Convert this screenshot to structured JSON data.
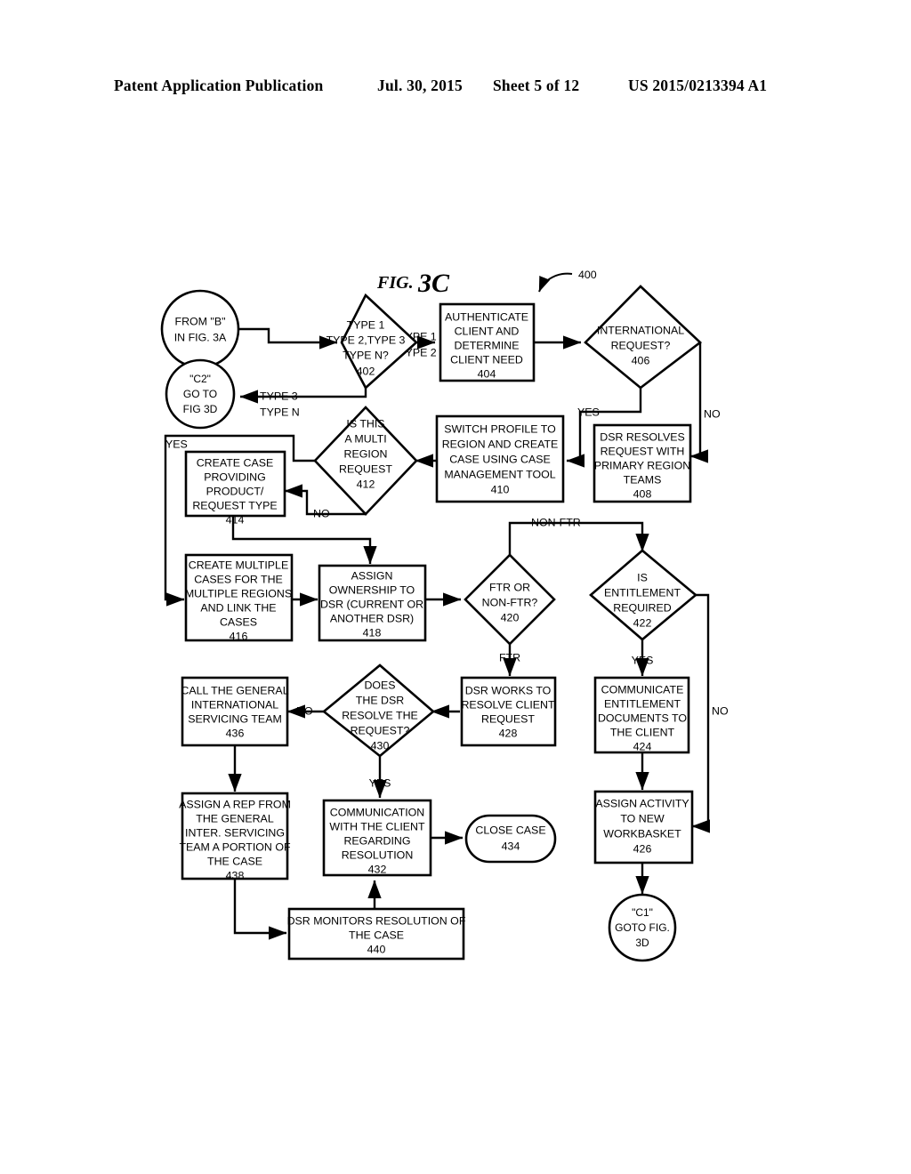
{
  "header": {
    "publication": "Patent Application Publication",
    "date": "Jul. 30, 2015",
    "sheet": "Sheet 5 of 12",
    "patent_number": "US 2015/0213394 A1"
  },
  "figure": {
    "title_prefix": "FIG.",
    "title_number": "3C",
    "diagram_ref": "400"
  },
  "nodes": {
    "from_b": {
      "id": "from_b",
      "shape": "circle",
      "lines": [
        "FROM \"B\"",
        "IN FIG. 3A"
      ],
      "ref": ""
    },
    "c2": {
      "id": "c2",
      "shape": "circle",
      "lines": [
        "\"C2\"",
        "GO TO",
        "FIG 3D"
      ],
      "ref": ""
    },
    "n402": {
      "id": "n402",
      "shape": "diamond",
      "lines": [
        "TYPE 1",
        "TYPE 2,TYPE 3",
        "TYPE N?"
      ],
      "ref": "402"
    },
    "n404": {
      "id": "n404",
      "shape": "process",
      "lines": [
        "AUTHENTICATE",
        "CLIENT AND",
        "DETERMINE",
        "CLIENT NEED"
      ],
      "ref": "404"
    },
    "n406": {
      "id": "n406",
      "shape": "diamond",
      "lines": [
        "INTERNATIONAL",
        "REQUEST?"
      ],
      "ref": "406"
    },
    "n408": {
      "id": "n408",
      "shape": "process",
      "lines": [
        "DSR RESOLVES",
        "REQUEST WITH",
        "PRIMARY REGION",
        "TEAMS"
      ],
      "ref": "408"
    },
    "n410": {
      "id": "n410",
      "shape": "process",
      "lines": [
        "SWITCH PROFILE TO",
        "REGION AND CREATE",
        "CASE USING CASE",
        "MANAGEMENT TOOL"
      ],
      "ref": "410"
    },
    "n412": {
      "id": "n412",
      "shape": "diamond",
      "lines": [
        "IS THIS",
        "A MULTI",
        "REGION",
        "REQUEST"
      ],
      "ref": "412"
    },
    "n414": {
      "id": "n414",
      "shape": "process",
      "lines": [
        "CREATE CASE",
        "PROVIDING",
        "PRODUCT/",
        "REQUEST TYPE"
      ],
      "ref": "414"
    },
    "n416": {
      "id": "n416",
      "shape": "process",
      "lines": [
        "CREATE MULTIPLE",
        "CASES FOR THE",
        "MULTIPLE REGIONS",
        "AND LINK THE",
        "CASES"
      ],
      "ref": "416"
    },
    "n418": {
      "id": "n418",
      "shape": "process",
      "lines": [
        "ASSIGN",
        "OWNERSHIP TO",
        "DSR (CURRENT OR",
        "ANOTHER DSR)"
      ],
      "ref": "418"
    },
    "n420": {
      "id": "n420",
      "shape": "diamond",
      "lines": [
        "FTR OR",
        "NON-FTR?"
      ],
      "ref": "420"
    },
    "n422": {
      "id": "n422",
      "shape": "diamond",
      "lines": [
        "IS",
        "ENTITLEMENT",
        "REQUIRED"
      ],
      "ref": "422"
    },
    "n424": {
      "id": "n424",
      "shape": "process",
      "lines": [
        "COMMUNICATE",
        "ENTITLEMENT",
        "DOCUMENTS TO",
        "THE CLIENT"
      ],
      "ref": "424"
    },
    "n426": {
      "id": "n426",
      "shape": "process",
      "lines": [
        "ASSIGN ACTIVITY",
        "TO NEW",
        "WORKBASKET"
      ],
      "ref": "426"
    },
    "n428": {
      "id": "n428",
      "shape": "process",
      "lines": [
        "DSR WORKS TO",
        "RESOLVE CLIENT",
        "REQUEST"
      ],
      "ref": "428"
    },
    "n430": {
      "id": "n430",
      "shape": "diamond",
      "lines": [
        "DOES",
        "THE DSR",
        "RESOLVE THE",
        "REQUEST?"
      ],
      "ref": "430"
    },
    "n432": {
      "id": "n432",
      "shape": "process",
      "lines": [
        "COMMUNICATION",
        "WITH THE CLIENT",
        "REGARDING",
        "RESOLUTION"
      ],
      "ref": "432"
    },
    "n434": {
      "id": "n434",
      "shape": "terminal",
      "lines": [
        "CLOSE CASE"
      ],
      "ref": "434"
    },
    "n436": {
      "id": "n436",
      "shape": "process",
      "lines": [
        "CALL THE GENERAL",
        "INTERNATIONAL",
        "SERVICING TEAM"
      ],
      "ref": "436"
    },
    "n438": {
      "id": "n438",
      "shape": "process",
      "lines": [
        "ASSIGN A REP FROM",
        "THE GENERAL",
        "INTER. SERVICING",
        "TEAM  A PORTION OF",
        "THE CASE"
      ],
      "ref": "438"
    },
    "n440": {
      "id": "n440",
      "shape": "process",
      "lines": [
        "DSR MONITORS RESOLUTION OF",
        "THE CASE"
      ],
      "ref": "440"
    },
    "c1": {
      "id": "c1",
      "shape": "circle",
      "lines": [
        "\"C1\"",
        "GOTO FIG.",
        "3D"
      ],
      "ref": ""
    }
  },
  "edge_labels": {
    "type12_a": "TYPE 1",
    "type12_b": "TYPE 2",
    "type3n_a": "TYPE 3",
    "type3n_b": "TYPE N",
    "intl_yes": "YES",
    "intl_no": "NO",
    "multi_yes": "YES",
    "multi_no": "NO",
    "ftr": "FTR",
    "non_ftr": "NON-FTR",
    "ent_yes": "YES",
    "ent_no": "NO",
    "resolve_no": "NO",
    "resolve_yes": "YES"
  }
}
